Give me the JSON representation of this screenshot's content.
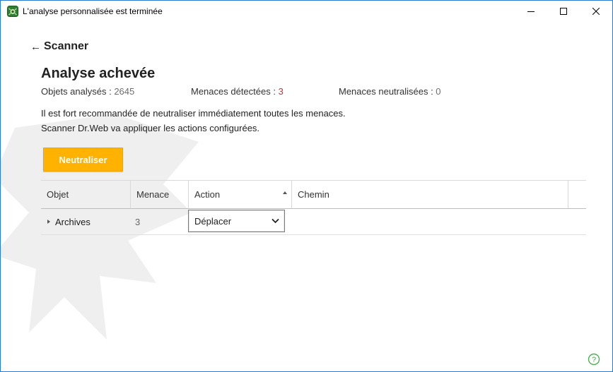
{
  "window": {
    "title": "L'analyse personnalisée est terminée",
    "controls": [
      "minimize-icon",
      "maximize-icon",
      "close-icon"
    ]
  },
  "nav": {
    "back_label": "Scanner"
  },
  "summary": {
    "heading": "Analyse achevée",
    "scanned_label": "Objets analysés : ",
    "scanned_value": "2645",
    "detected_label": "Menaces détectées : ",
    "detected_value": "3",
    "neutralized_label": "Menaces neutralisées : ",
    "neutralized_value": "0"
  },
  "message": {
    "line1": "Il est fort recommandée de neutraliser immédiatement toutes les menaces.",
    "line2": "Scanner Dr.Web va appliquer les actions configurées."
  },
  "actions": {
    "neutralize_label": "Neutraliser"
  },
  "table": {
    "headers": {
      "object": "Objet",
      "threat": "Menace",
      "action": "Action",
      "path": "Chemin"
    },
    "sorted_column": "Action",
    "rows": [
      {
        "object": "Archives",
        "threat": "3",
        "action": "Déplacer",
        "path": ""
      }
    ]
  },
  "colors": {
    "accent": "#ffb300",
    "detected": "#d32f2f",
    "window_border": "#2b7bd0"
  },
  "icons": {
    "app": "drweb-spider-icon",
    "help": "help-icon"
  }
}
